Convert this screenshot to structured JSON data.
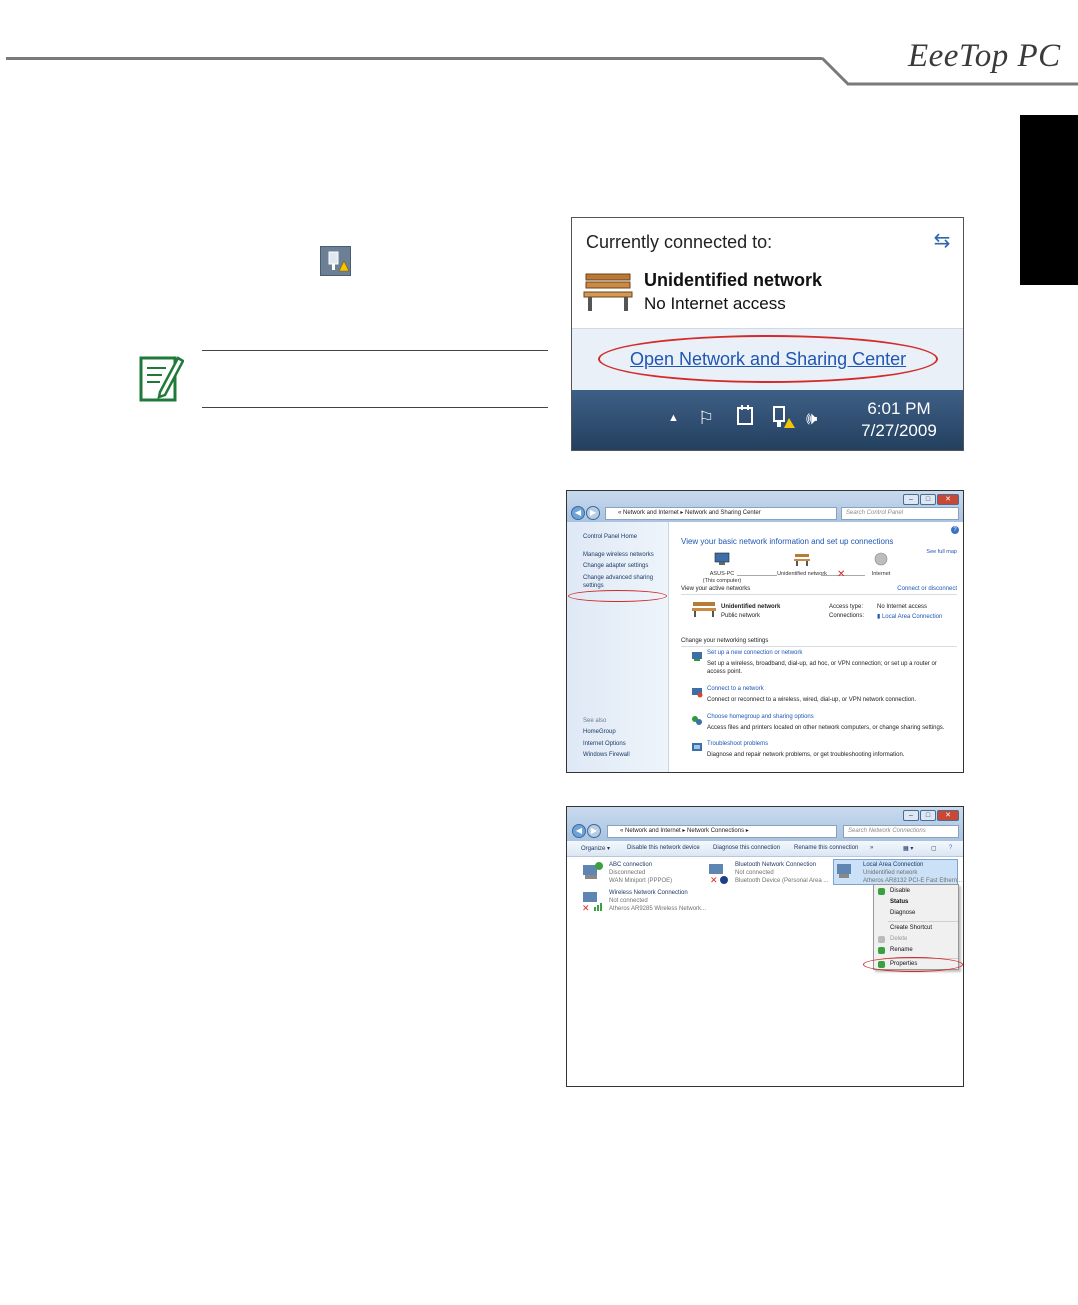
{
  "header": {
    "logo": "EeeTop PC"
  },
  "note": {},
  "shot1": {
    "title": "Currently connected to:",
    "network_name": "Unidentified network",
    "network_status": "No Internet access",
    "link": "Open Network and Sharing Center",
    "time": "6:01 PM",
    "date": "7/27/2009"
  },
  "shot2": {
    "address": "«  Network and Internet  ▸  Network and Sharing Center",
    "search_placeholder": "Search Control Panel",
    "sidebar": {
      "home": "Control Panel Home",
      "items": [
        "Manage wireless networks",
        "Change adapter settings",
        "Change advanced sharing",
        "settings"
      ],
      "see_also": "See also",
      "see_also_items": [
        "HomeGroup",
        "Internet Options",
        "Windows Firewall"
      ]
    },
    "heading": "View your basic network information and set up connections",
    "full_map": "See full map",
    "nodes": {
      "pc": "ASUS-PC",
      "pc_sub": "(This computer)",
      "network": "Unidentified network",
      "internet": "Internet"
    },
    "active_label": "View your active networks",
    "connect_link": "Connect or disconnect",
    "active": {
      "name": "Unidentified network",
      "type": "Public network",
      "access_label": "Access type:",
      "access_value": "No Internet access",
      "connections_label": "Connections:",
      "connections_value": "Local Area Connection"
    },
    "change_label": "Change your networking settings",
    "tasks": [
      {
        "title": "Set up a new connection or network",
        "desc": "Set up a wireless, broadband, dial-up, ad hoc, or VPN connection; or set up a router or access point."
      },
      {
        "title": "Connect to a network",
        "desc": "Connect or reconnect to a wireless, wired, dial-up, or VPN network connection."
      },
      {
        "title": "Choose homegroup and sharing options",
        "desc": "Access files and printers located on other network computers, or change sharing settings."
      },
      {
        "title": "Troubleshoot problems",
        "desc": "Diagnose and repair network problems, or get troubleshooting information."
      }
    ]
  },
  "shot3": {
    "address": "«  Network and Internet  ▸  Network Connections  ▸",
    "search_placeholder": "Search Network Connections",
    "toolbar": {
      "organize": "Organize ▾",
      "disable": "Disable this network device",
      "diagnose": "Diagnose this connection",
      "rename": "Rename this connection",
      "more": "»"
    },
    "connections": [
      {
        "name": "ABC connection",
        "status": "Disconnected",
        "device": "WAN Miniport (PPPOE)"
      },
      {
        "name": "Bluetooth Network Connection",
        "status": "Not connected",
        "device": "Bluetooth Device (Personal Area ..."
      },
      {
        "name": "Local Area Connection",
        "status": "Unidentified network",
        "device": "Atheros AR8132 PCI-E Fast Ethern..."
      },
      {
        "name": "Wireless Network Connection",
        "status": "Not connected",
        "device": "Atheros AR9285 Wireless Network..."
      }
    ],
    "menu": [
      "Disable",
      "Status",
      "Diagnose",
      "Create Shortcut",
      "Delete",
      "Rename",
      "Properties"
    ]
  }
}
